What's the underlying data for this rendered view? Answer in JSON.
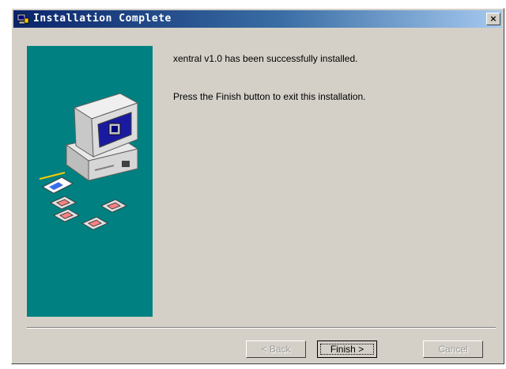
{
  "window": {
    "title": "Installation Complete",
    "close_label": "×"
  },
  "content": {
    "line1": "xentral v1.0 has been successfully installed.",
    "line2": "Press the Finish button to exit this installation."
  },
  "buttons": {
    "back": "< Back",
    "finish": "Finish >",
    "cancel": "Cancel"
  },
  "icons": {
    "title": "installer-icon",
    "illustration": "computer-with-disks-illustration"
  },
  "colors": {
    "title_bar": "#0a246a",
    "side_panel": "#008080",
    "dialog_face": "#d4d0c8"
  }
}
